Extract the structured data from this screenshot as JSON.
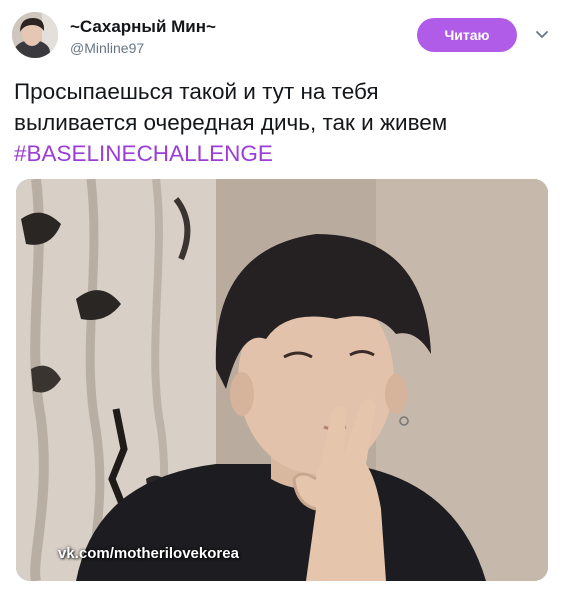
{
  "tweet": {
    "author": {
      "display_name": "~Сахарный Мин~",
      "handle": "@Minline97",
      "avatar_icon": "profile-photo"
    },
    "follow_button_label": "Читаю",
    "menu_icon": "chevron-down-icon",
    "text_line_1": "Просыпаешься такой и тут на тебя",
    "text_line_2": "выливается очередная дичь, так и живем",
    "hashtag": "#BASELINECHALLENGE",
    "media": {
      "watermark": "vk.com/motherilovekorea"
    }
  },
  "colors": {
    "accent": "#b05ce8",
    "hashtag": "#9b3dd6",
    "text": "#14171a",
    "secondary_text": "#657786"
  }
}
